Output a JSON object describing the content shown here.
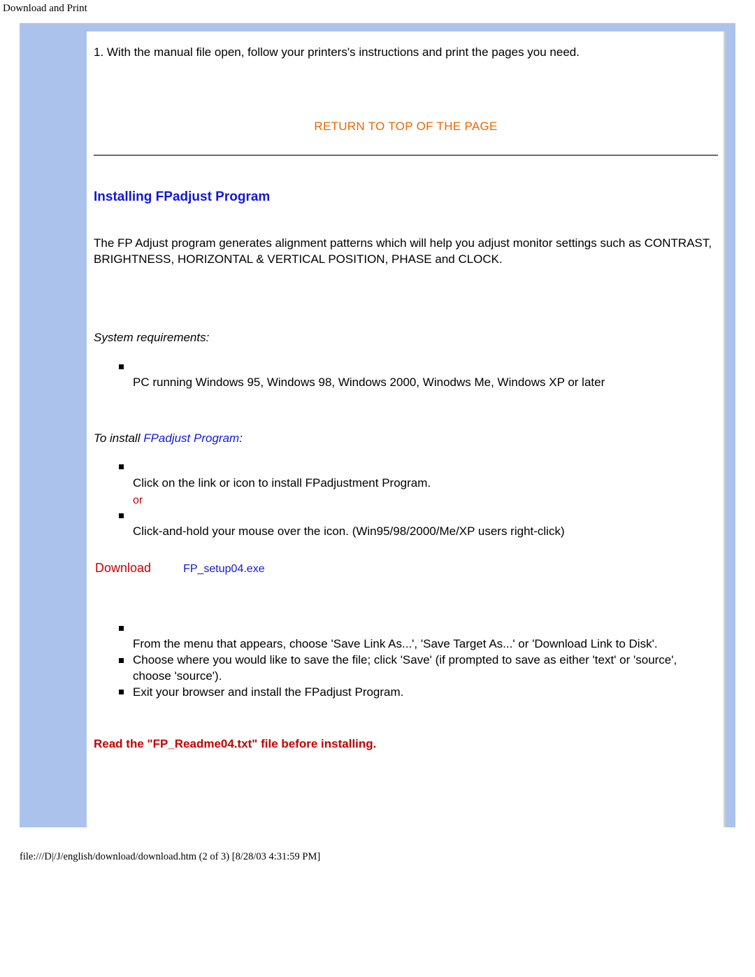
{
  "header_title": "Download and Print",
  "instruction_1": "1. With the manual file open, follow your printers's instructions and print the pages you need.",
  "return_link": "RETURN TO TOP OF THE PAGE",
  "section_heading": "Installing FPadjust Program",
  "intro_para": "The FP Adjust program generates alignment patterns which will help you adjust monitor settings such as CONTRAST, BRIGHTNESS, HORIZONTAL & VERTICAL POSITION, PHASE and CLOCK.",
  "sysreq_label": "System requirements:",
  "sysreq_items": [
    "PC running Windows 95, Windows 98, Windows 2000, Winodws Me, Windows XP or later"
  ],
  "install_label_prefix": "To install ",
  "install_label_link": "FPadjust Program",
  "install_label_suffix": ":",
  "install_items_a": [
    "Click on the link or icon to install FPadjustment Program.",
    "Click-and-hold your mouse over the icon. (Win95/98/2000/Me/XP users right-click)"
  ],
  "or_text": "or",
  "download_label": "Download",
  "download_file": "FP_setup04.exe",
  "install_items_b": [
    "From the menu that appears, choose 'Save Link As...', 'Save Target As...' or 'Download Link to Disk'.",
    "Choose where you would like to save the file; click 'Save' (if prompted to save as either 'text' or 'source', choose 'source').",
    "Exit your browser and install the FPadjust Program."
  ],
  "readme_note": "Read the \"FP_Readme04.txt\" file before installing.",
  "footer_path": "file:///D|/J/english/download/download.htm (2 of 3) [8/28/03 4:31:59 PM]"
}
